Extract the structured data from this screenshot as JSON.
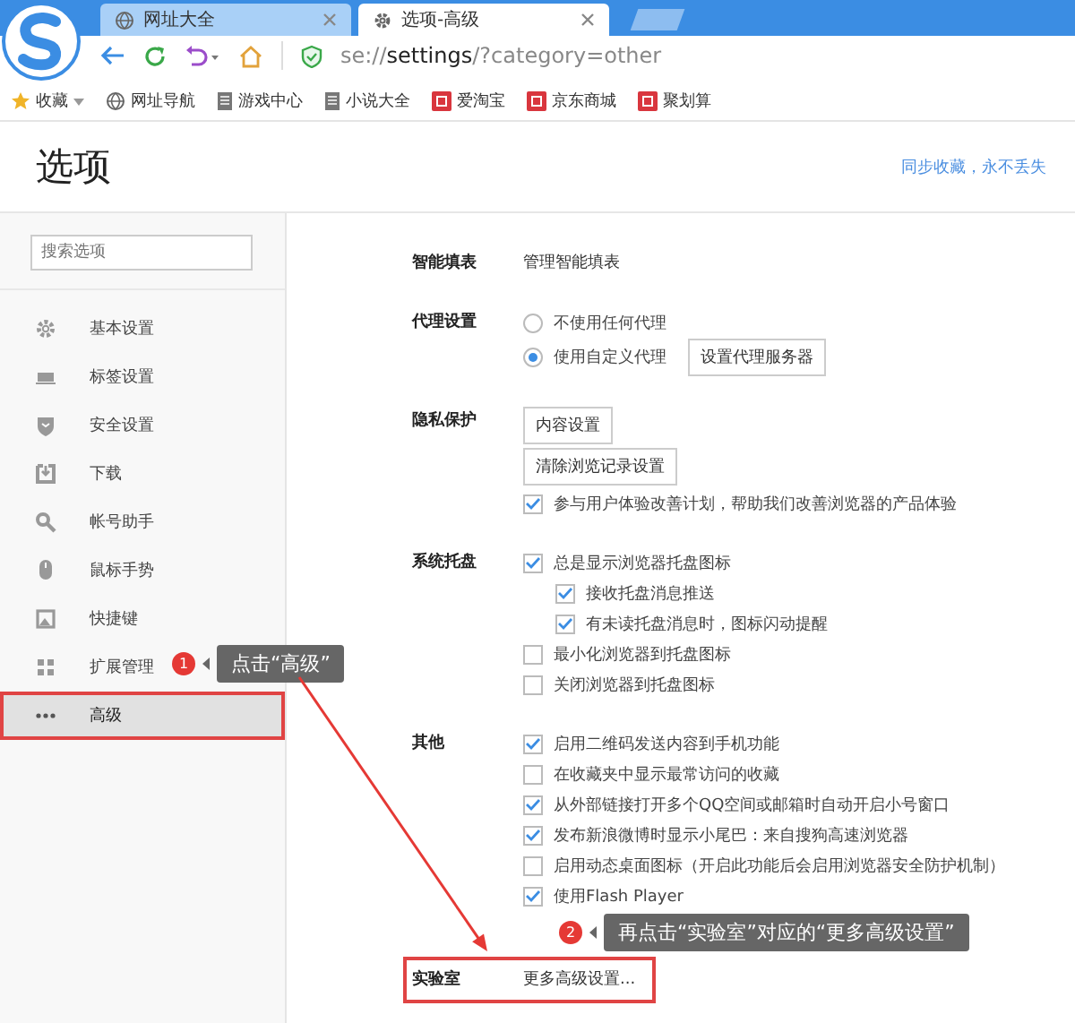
{
  "browser": {
    "tabs": [
      {
        "label": "网址大全",
        "selected": false
      },
      {
        "label": "选项-高级",
        "selected": true
      }
    ],
    "address": "se://**settings**/?category=other",
    "bookmarks": [
      {
        "label": "收藏",
        "kind": "star"
      },
      {
        "label": "网址导航",
        "kind": "globe"
      },
      {
        "label": "游戏中心",
        "kind": "page"
      },
      {
        "label": "小说大全",
        "kind": "page"
      },
      {
        "label": "爱淘宝",
        "kind": "red"
      },
      {
        "label": "京东商城",
        "kind": "red"
      },
      {
        "label": "聚划算",
        "kind": "red"
      }
    ]
  },
  "header": {
    "title": "选项",
    "link": "同步收藏，永不丢失"
  },
  "sidebar": {
    "search": {
      "placeholder": "搜索选项"
    },
    "items": [
      {
        "label": "基本设置",
        "selected": false,
        "annotated": false
      },
      {
        "label": "标签设置",
        "selected": false,
        "annotated": false
      },
      {
        "label": "安全设置",
        "selected": false,
        "annotated": false
      },
      {
        "label": "下载",
        "selected": false,
        "annotated": false
      },
      {
        "label": "帐号助手",
        "selected": false,
        "annotated": false
      },
      {
        "label": "鼠标手势",
        "selected": false,
        "annotated": false
      },
      {
        "label": "快捷键",
        "selected": false,
        "annotated": false
      },
      {
        "label": "扩展管理",
        "selected": false,
        "annotated": false
      },
      {
        "label": "高级",
        "selected": true,
        "annotated": true
      }
    ]
  },
  "sections": [
    {
      "label": "智能填表",
      "annotated": false,
      "items": [
        {
          "kind": "link",
          "label": "管理智能填表"
        }
      ]
    },
    {
      "label": "代理设置",
      "annotated": false,
      "items": [
        {
          "kind": "radio",
          "label": "不使用任何代理",
          "selected": false
        },
        {
          "kind": "radio",
          "label": "使用自定义代理",
          "selected": true,
          "button": "设置代理服务器"
        }
      ]
    },
    {
      "label": "隐私保护",
      "annotated": false,
      "items": [
        {
          "kind": "button",
          "label": "内容设置"
        },
        {
          "kind": "button",
          "label": "清除浏览记录设置"
        },
        {
          "kind": "checkbox",
          "label": "参与用户体验改善计划，帮助我们改善浏览器的产品体验",
          "checked": true
        }
      ]
    },
    {
      "label": "系统托盘",
      "annotated": false,
      "items": [
        {
          "kind": "checkbox",
          "label": "总是显示浏览器托盘图标",
          "checked": true,
          "children": [
            {
              "kind": "checkbox",
              "label": "接收托盘消息推送",
              "checked": true
            },
            {
              "kind": "checkbox",
              "label": "有未读托盘消息时，图标闪动提醒",
              "checked": true
            }
          ]
        },
        {
          "kind": "checkbox",
          "label": "最小化浏览器到托盘图标",
          "checked": false
        },
        {
          "kind": "checkbox",
          "label": "关闭浏览器到托盘图标",
          "checked": false
        }
      ]
    },
    {
      "label": "其他",
      "annotated": false,
      "items": [
        {
          "kind": "checkbox",
          "label": "启用二维码发送内容到手机功能",
          "checked": true
        },
        {
          "kind": "checkbox",
          "label": "在收藏夹中显示最常访问的收藏",
          "checked": false
        },
        {
          "kind": "checkbox",
          "label": "从外部链接打开多个QQ空间或邮箱时自动开启小号窗口",
          "checked": true
        },
        {
          "kind": "checkbox",
          "label": "发布新浪微博时显示小尾巴：来自搜狗高速浏览器",
          "checked": true
        },
        {
          "kind": "checkbox",
          "label": "启用动态桌面图标（开启此功能后会启用浏览器安全防护机制）",
          "checked": false
        },
        {
          "kind": "checkbox",
          "label": "使用Flash Player",
          "checked": true
        }
      ]
    },
    {
      "label": "实验室",
      "annotated": true,
      "items": [
        {
          "kind": "link",
          "label": "更多高级设置..."
        }
      ]
    }
  ],
  "annotations": [
    {
      "number": "1",
      "text": "点击“高级”"
    },
    {
      "number": "2",
      "text": "再点击“实验室”对应的“更多高级设置”"
    }
  ]
}
